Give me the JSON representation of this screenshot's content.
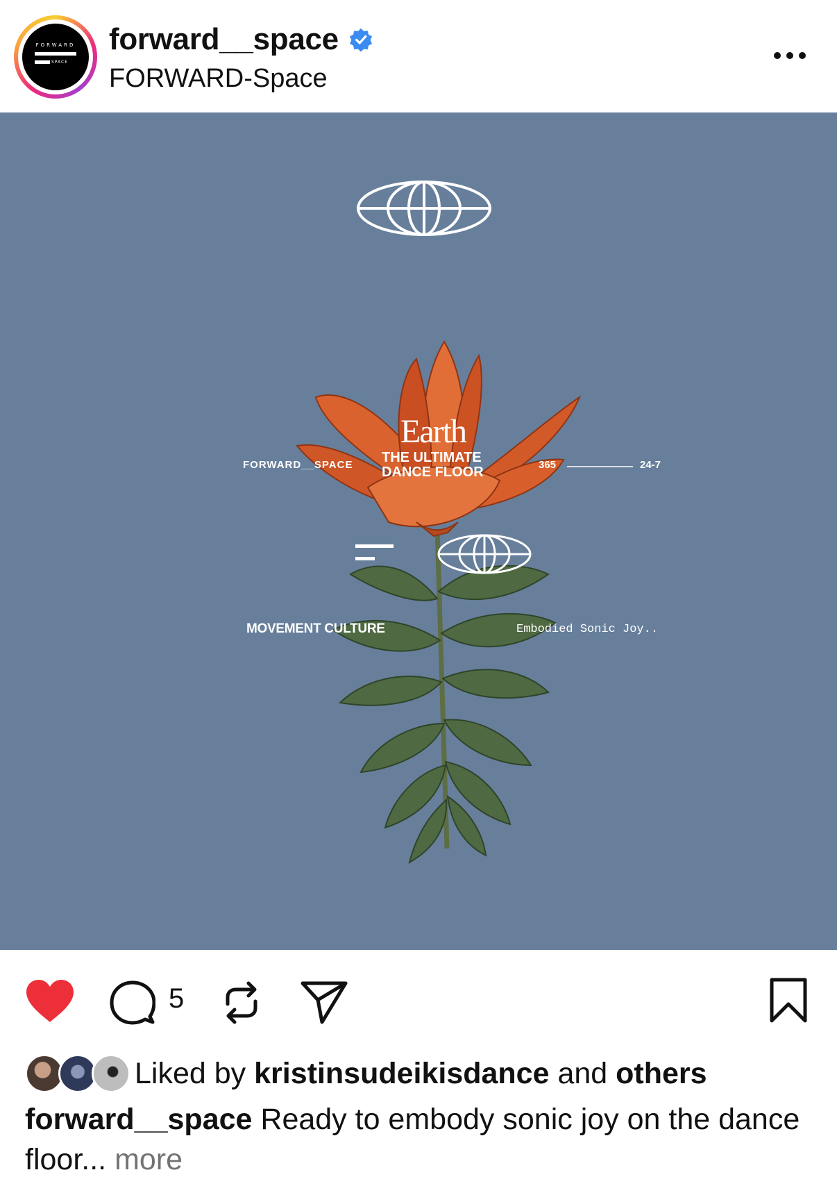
{
  "header": {
    "username": "forward__space",
    "display_name": "FORWARD-Space",
    "avatar_logo_top": "FORWARD",
    "avatar_logo_bottom": "SPACE",
    "verified_icon": "verified-badge-icon",
    "more_icon": "more-options-icon"
  },
  "post": {
    "brand": "FORWARD__SPACE",
    "title_script": "Earth",
    "headline_line1": "THE ULTIMATE",
    "headline_line2": "DANCE FLOOR",
    "left_label": "365",
    "right_label": "24-7",
    "movement": "MOVEMENT CULTURE",
    "tagline": "Embodied Sonic Joy..",
    "background_color": "#677f9b"
  },
  "actions": {
    "like_icon": "heart-filled-icon",
    "comment_icon": "comment-icon",
    "comment_count": "5",
    "repost_icon": "repost-icon",
    "share_icon": "send-icon",
    "save_icon": "bookmark-icon",
    "like_color": "#ed2f3a"
  },
  "likes": {
    "prefix": "Liked by ",
    "user": "kristinsudeikisdance",
    "middle": " and ",
    "others": "others"
  },
  "caption": {
    "username": "forward__space",
    "text": " Ready to embody sonic joy on the dance floor...",
    "more": " more"
  }
}
